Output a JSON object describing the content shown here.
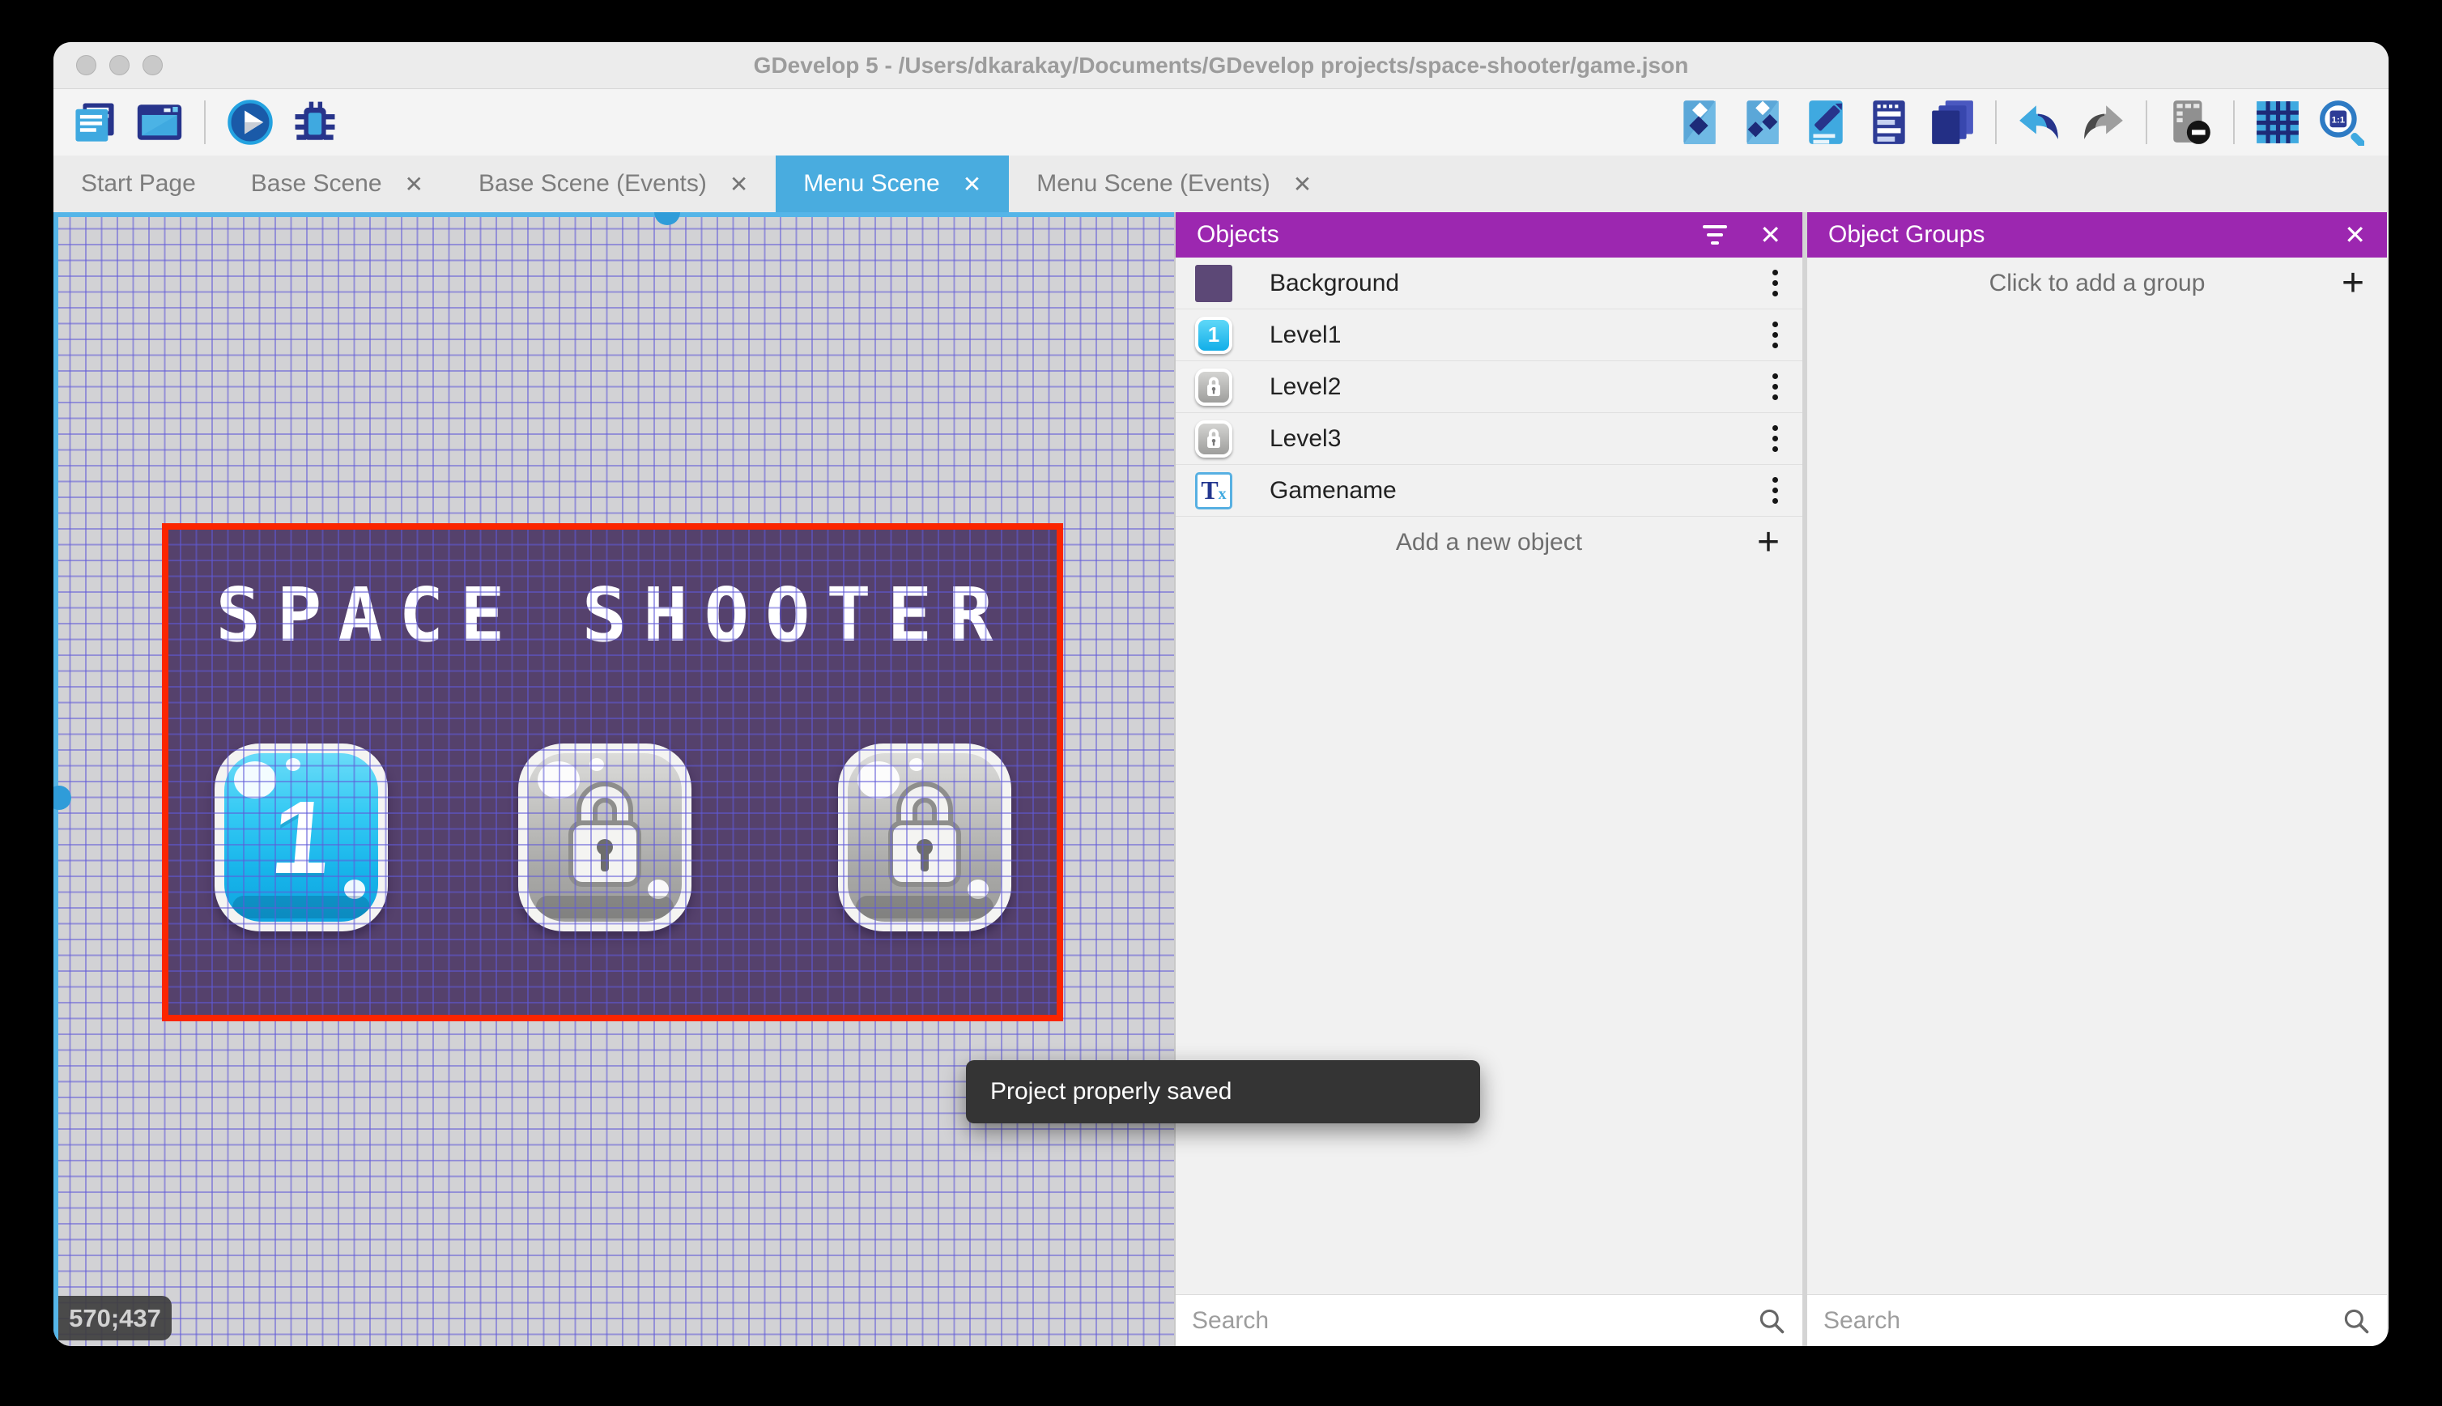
{
  "window_title": "GDevelop 5 - /Users/dkarakay/Documents/GDevelop projects/space-shooter/game.json",
  "icons": {
    "close": "✕",
    "plus": "+"
  },
  "toolbar": {
    "zoom_icon_label": "1:1"
  },
  "tabs": [
    {
      "label": "Start Page",
      "active": false,
      "closable": false
    },
    {
      "label": "Base Scene",
      "active": false,
      "closable": true
    },
    {
      "label": "Base Scene (Events)",
      "active": false,
      "closable": true
    },
    {
      "label": "Menu Scene",
      "active": true,
      "closable": true
    },
    {
      "label": "Menu Scene (Events)",
      "active": false,
      "closable": true
    }
  ],
  "canvas": {
    "coordinates": "570;437",
    "scene_title": "SPACE SHOOTER",
    "level1_label": "1"
  },
  "objects_panel": {
    "title": "Objects",
    "items": [
      {
        "label": "Background"
      },
      {
        "label": "Level1"
      },
      {
        "label": "Level2"
      },
      {
        "label": "Level3"
      },
      {
        "label": "Gamename"
      }
    ],
    "gamename_icon": {
      "t": "T",
      "x": "x"
    },
    "add_label": "Add a new object",
    "search_placeholder": "Search"
  },
  "groups_panel": {
    "title": "Object Groups",
    "empty_label": "Click to add a group",
    "search_placeholder": "Search"
  },
  "toast": "Project properly saved",
  "colors": {
    "panel_header": "#9C27B0",
    "active_tab": "#49ACDF",
    "selection": "#FB2500"
  }
}
